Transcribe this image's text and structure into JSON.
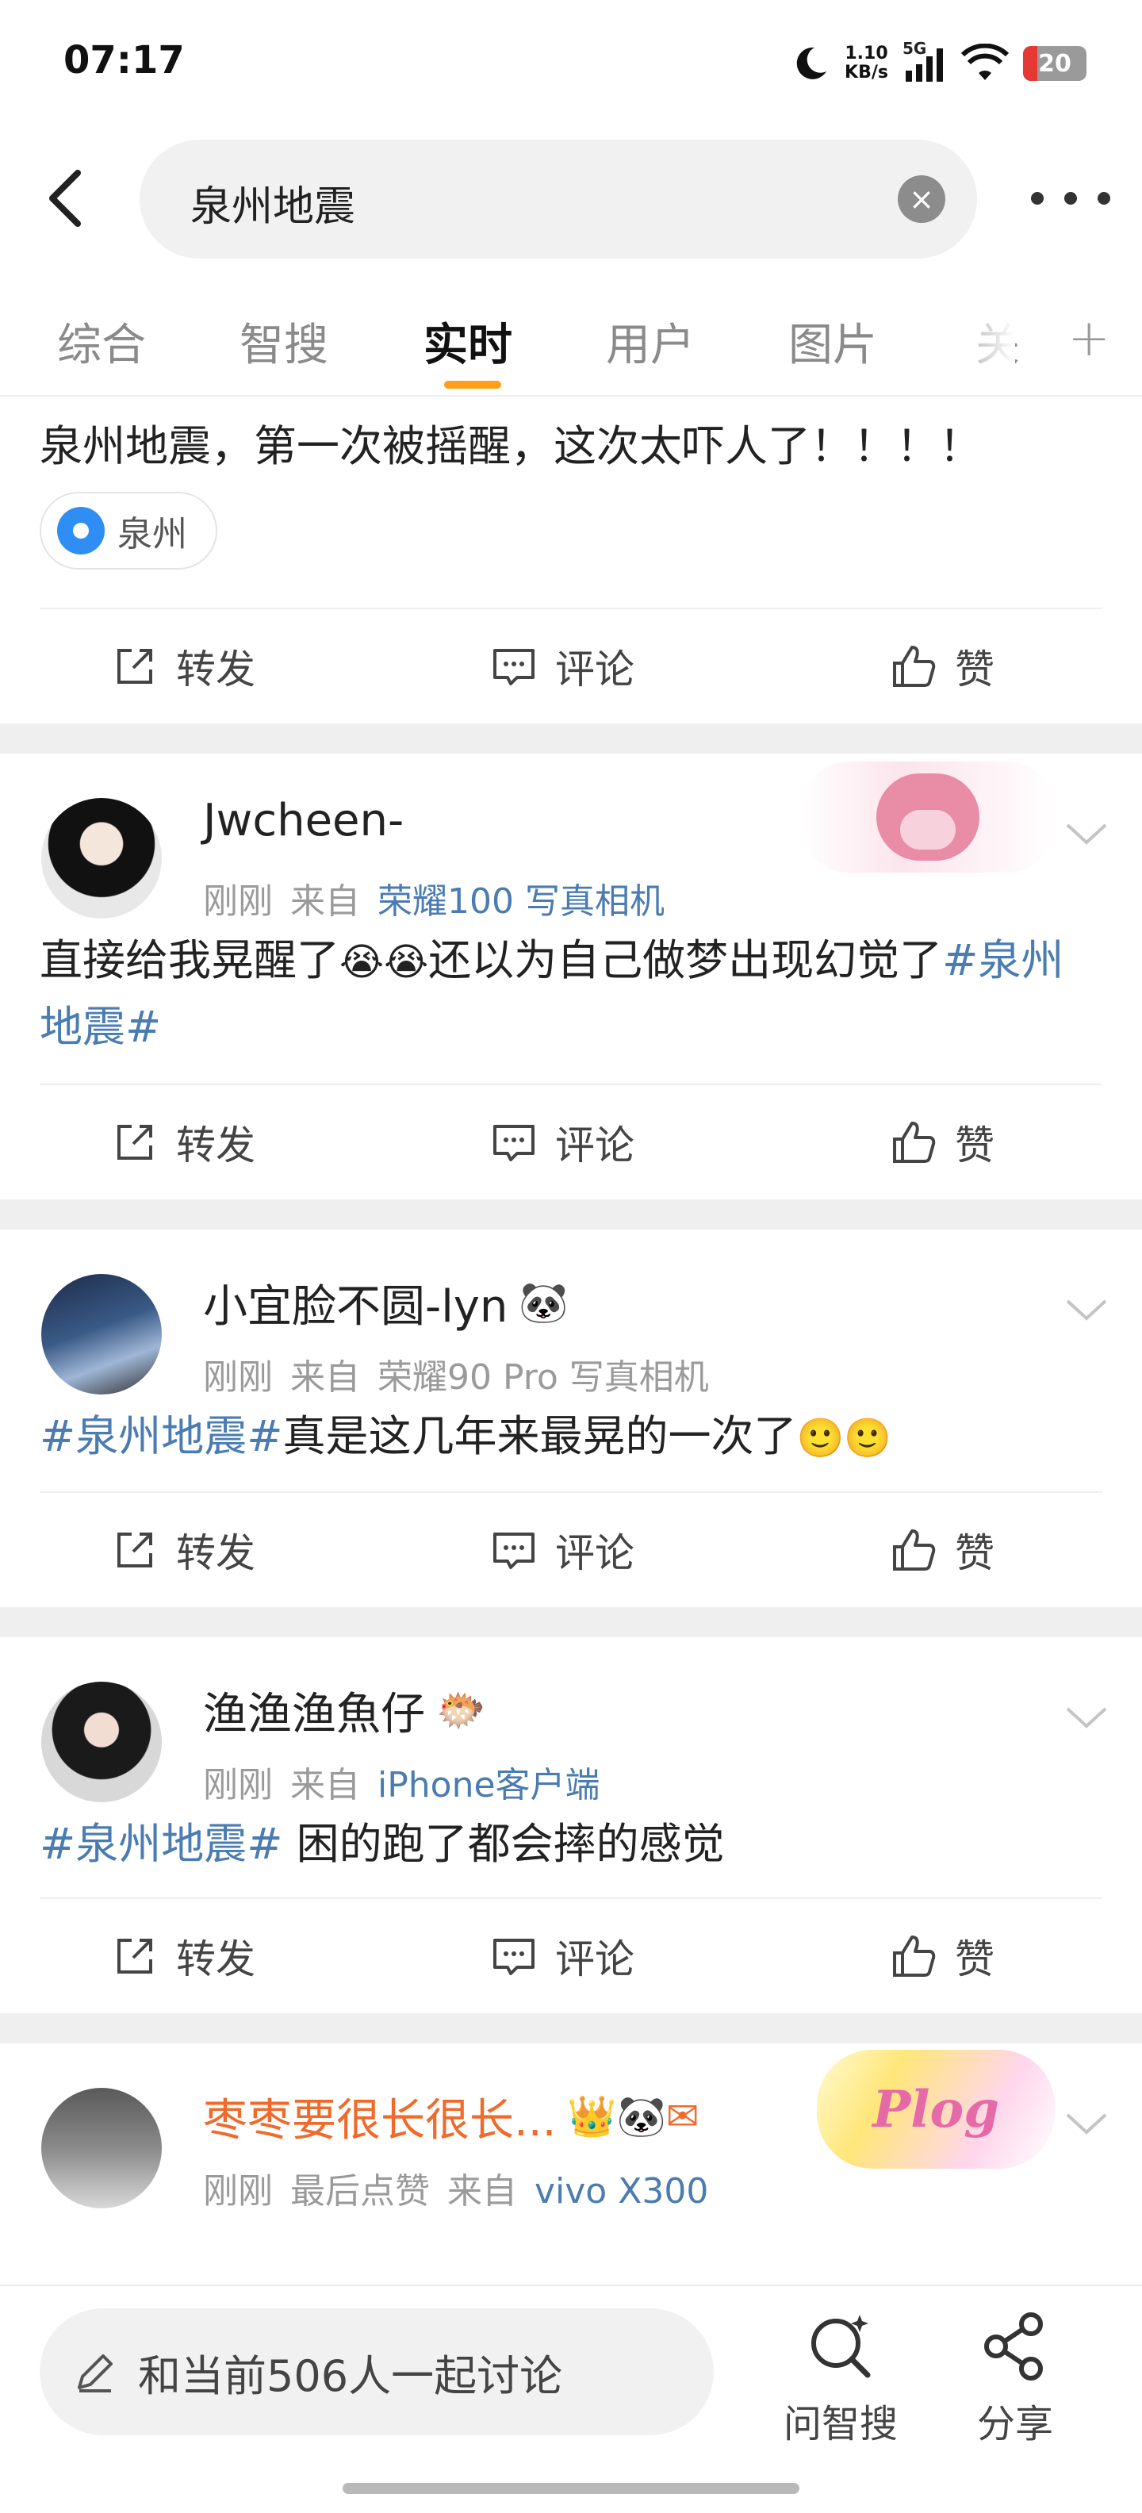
{
  "status": {
    "time": "07:17",
    "net_speed_top": "1.10",
    "net_speed_bottom": "KB/s",
    "network": "5G",
    "battery": "20"
  },
  "search": {
    "query": "泉州地震"
  },
  "tabs": [
    "综合",
    "智搜",
    "实时",
    "用户",
    "图片",
    "关"
  ],
  "active_tab": "实时",
  "actions": {
    "repost": "转发",
    "comment": "评论",
    "like": "赞"
  },
  "posts": [
    {
      "text": "泉州地震，第一次被摇醒，这次太吓人了！！！！",
      "location": "泉州"
    },
    {
      "user": "Jwcheen-",
      "time": "刚刚",
      "from": "来自",
      "device": "荣耀100 写真相机",
      "text_a": "直接给我晃醒了",
      "emoji": "😭😭",
      "text_b": "还以为自己做梦出现幻觉了",
      "topic": "#泉州地震#"
    },
    {
      "user": "小宜脸不圆-lyn",
      "user_badge": "🐼",
      "time": "刚刚",
      "from": "来自",
      "device": "荣耀90 Pro 写真相机",
      "topic": "#泉州地震#",
      "text": "真是这几年来最晃的一次了",
      "emoji": "🙂🙂"
    },
    {
      "user": "渔渔渔魚仔",
      "user_badge": "🐡",
      "time": "刚刚",
      "from": "来自",
      "device": "iPhone客户端",
      "topic": "#泉州地震#",
      "text": " 困的跑了都会摔的感觉"
    },
    {
      "user": "枣枣要很长很长...",
      "user_badges": "👑🐼✉",
      "time": "刚刚",
      "extra": "最后点赞",
      "from": "来自",
      "device": "vivo X300",
      "sticker": "Plog"
    }
  ],
  "bottom": {
    "discuss": "和当前506人一起讨论",
    "ask": "问智搜",
    "share": "分享"
  },
  "colors": {
    "topic": "#4a7bb1",
    "accent_underline": "#ff9f1a",
    "vip_name": "#ef6a2b"
  }
}
